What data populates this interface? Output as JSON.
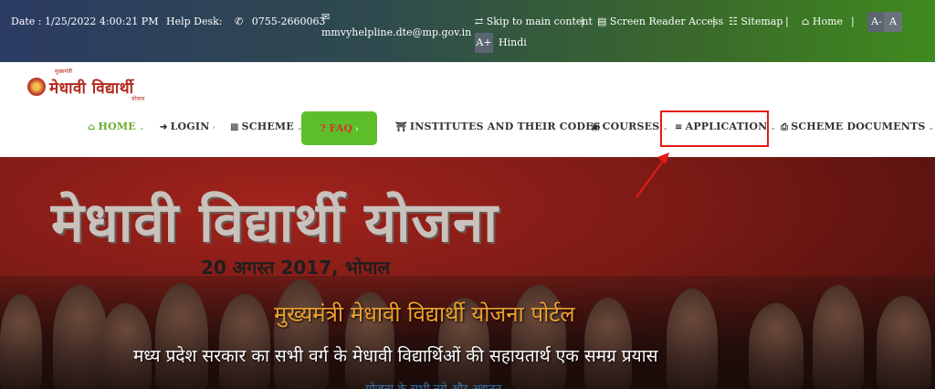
{
  "topbar": {
    "date": "Date : 1/25/2022 4:00:21 PM",
    "helpdesk_label": "Help Desk:",
    "phone": "0755-2660063",
    "email": "mmvyhelpline.dte@mp.gov.in",
    "skip_label": "Skip to main content",
    "screen_reader_label": "Screen Reader Access",
    "sitemap_label": "Sitemap",
    "home_label": "Home",
    "font_minus": "A-",
    "font_normal": "A",
    "font_plus": "A+",
    "hindi_label": "Hindi",
    "separator": "|"
  },
  "logo": {
    "text": "मेधावी विद्यार्थी",
    "small_top": "मुख्यमंत्री",
    "small_bottom": "योजना"
  },
  "nav": {
    "home": "HOME",
    "login": "LOGIN",
    "scheme": "SCHEME",
    "faq": "? FAQ",
    "institutes": "INSTITUTES AND THEIR CODES",
    "courses": "COURSES",
    "application": "APPLICATION",
    "scheme_documents": "SCHEME DOCUMENTS"
  },
  "hero": {
    "title": "मेधावी विद्यार्थी योजना",
    "date_line": "20 अगस्त 2017, भोपाल",
    "portal_title": "मुख्यमंत्री मेधावी विद्यार्थी योजना पोर्टल",
    "tagline": "मध्य प्रदेश सरकार का सभी वर्ग के मेधावी विद्यार्थिओं की सहायतार्थ एक समग्र प्रयास",
    "faded_line": "योजना के सभी नये और अद्यतन"
  },
  "colors": {
    "accent_green": "#5cbf2a",
    "highlight_red": "#e41b17",
    "home_green": "#6aac2e"
  }
}
